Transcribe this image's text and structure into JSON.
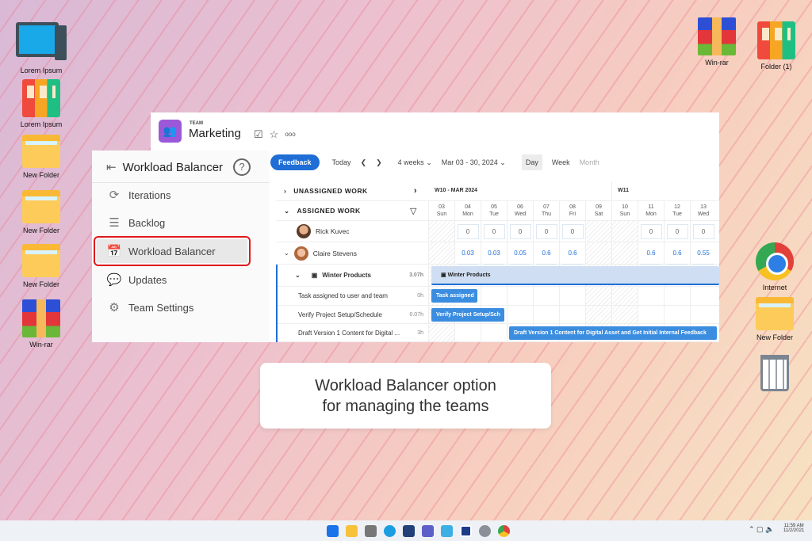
{
  "desktop": {
    "left": [
      {
        "label": "Lorem Ipsum",
        "icon": "monitor-icon"
      },
      {
        "label": "Lorem Ipsum",
        "icon": "binders-icon"
      },
      {
        "label": "New Folder",
        "icon": "folder-icon"
      },
      {
        "label": "New Folder",
        "icon": "folder-icon"
      },
      {
        "label": "New Folder",
        "icon": "folder-icon"
      },
      {
        "label": "Win-rar",
        "icon": "winrar-icon"
      }
    ],
    "right": [
      {
        "label": "Win-rar",
        "icon": "winrar-icon"
      },
      {
        "label": "Folder (1)",
        "icon": "binders-icon"
      },
      {
        "label": "Internet",
        "icon": "chrome-icon"
      },
      {
        "label": "New Folder",
        "icon": "folder-icon"
      }
    ]
  },
  "header": {
    "team_label": "TEAM",
    "team_name": "Marketing",
    "more": "ooo"
  },
  "sidebar": {
    "title": "Workload Balancer",
    "help": "?",
    "items": [
      {
        "label": "Iterations",
        "icon": "iterations-icon"
      },
      {
        "label": "Backlog",
        "icon": "backlog-icon"
      },
      {
        "label": "Workload Balancer",
        "icon": "calendar-check-icon",
        "active": true
      },
      {
        "label": "Updates",
        "icon": "chat-icon"
      },
      {
        "label": "Team Settings",
        "icon": "gear-icon"
      }
    ]
  },
  "toolbar": {
    "feedback": "Feedback",
    "today": "Today",
    "range": "4 weeks",
    "dates": "Mar 03 - 30, 2024",
    "views": [
      "Day",
      "Week",
      "Month"
    ],
    "active_view": "Day"
  },
  "grid": {
    "unassigned": "UNASSIGNED WORK",
    "assigned": "ASSIGNED WORK",
    "week1": "W10 - MAR 2024",
    "week2": "W11",
    "days": [
      {
        "d": "03",
        "w": "Sun",
        "we": true
      },
      {
        "d": "04",
        "w": "Mon"
      },
      {
        "d": "05",
        "w": "Tue"
      },
      {
        "d": "06",
        "w": "Wed"
      },
      {
        "d": "07",
        "w": "Thu"
      },
      {
        "d": "08",
        "w": "Fri"
      },
      {
        "d": "09",
        "w": "Sat",
        "we": true
      },
      {
        "d": "10",
        "w": "Sun",
        "we": true
      },
      {
        "d": "11",
        "w": "Mon"
      },
      {
        "d": "12",
        "w": "Tue"
      },
      {
        "d": "13",
        "w": "Wed"
      }
    ],
    "users": [
      {
        "name": "Rick Kuvec",
        "values": [
          "",
          "0",
          "0",
          "0",
          "0",
          "0",
          "",
          "",
          "0",
          "0",
          "0"
        ]
      },
      {
        "name": "Claire Stevens",
        "values": [
          "",
          "0.03",
          "0.03",
          "0.05",
          "0.6",
          "0.6",
          "",
          "",
          "0.6",
          "0.6",
          "0.55"
        ]
      }
    ],
    "project": {
      "name": "Winter Products",
      "hours": "3.07h"
    },
    "tasks": [
      {
        "name": "Task assigned to user and team",
        "hours": "0h",
        "bar": "Task assigned"
      },
      {
        "name": "Verify Project Setup/Schedule",
        "hours": "0.07h",
        "bar": "Verify Project Setup/Sch"
      },
      {
        "name": "Draft Version 1 Content for Digital ...",
        "hours": "3h",
        "bar": "Draft Version 1 Content for Digital Asset and Get Initial Internal Feedback"
      }
    ]
  },
  "caption": {
    "line1": "Workload Balancer option",
    "line2": "for managing the teams"
  },
  "taskbar": {
    "time": "11:59 AM",
    "date": "11/2/2021"
  },
  "colors": {
    "accent": "#1f6ed6",
    "highlight": "#e0191c",
    "team": "#9b59d9"
  }
}
